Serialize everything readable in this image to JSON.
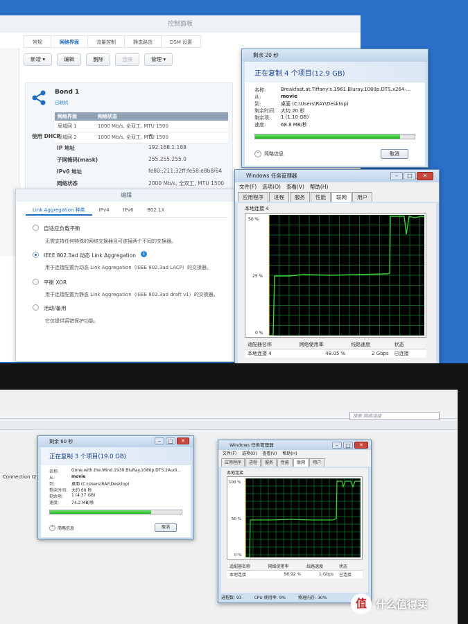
{
  "control_panel": {
    "title": "控制面板",
    "tabs": [
      "常规",
      "网络界面",
      "流量控制",
      "静态路由",
      "DSM 设置"
    ],
    "active_tab": 1,
    "toolbar": {
      "create": "新增 ▾",
      "edit": "编辑",
      "delete": "删除",
      "connect": "连接",
      "manage": "管理 ▾"
    },
    "bond": {
      "name": "Bond 1",
      "status": "已联机",
      "table_headers": [
        "网络界面",
        "网络状态"
      ],
      "interfaces": [
        {
          "name": "局域网 1",
          "status": "1000 Mb/s, 全双工, MTU 1500"
        },
        {
          "name": "局域网 2",
          "status": "1000 Mb/s, 全双工, MTU 1500"
        }
      ],
      "fields": [
        {
          "label": "使用 DHCP",
          "value": "否"
        },
        {
          "label": "IP 地址",
          "value": "192.168.1.188"
        },
        {
          "label": "子网掩码(mask)",
          "value": "255.255.255.0"
        },
        {
          "label": "IPv6 地址",
          "value": "fe80::211:32ff:fe58:e8b8/64"
        },
        {
          "label": "网络状态",
          "value": "2000 Mb/s, 全双工, MTU 1500"
        }
      ]
    }
  },
  "edit_dialog": {
    "title": "编辑",
    "tabs": [
      "Link Aggregation 种类",
      "IPv4",
      "IPv6",
      "802.1X"
    ],
    "options": [
      {
        "label": "自适应负载平衡",
        "desc": "无需支持任何特殊的网络交换器且可连接两个不同的交换器。",
        "selected": false
      },
      {
        "label": "IEEE 802.3ad 动态 Link Aggregation",
        "desc": "用于连接配置为动态 Link Aggregation（IEEE 802.3ad LACP）的交换器。",
        "selected": true
      },
      {
        "label": "平衡 XOR",
        "desc": "用于连接配置为静态 Link Aggregation（IEEE 802.3ad draft v1）的交换器。",
        "selected": false
      },
      {
        "label": "活动/备用",
        "desc": "它仅提供容错保护功能。",
        "selected": false
      }
    ]
  },
  "copy_dialog_top": {
    "title": "剩余 20 秒",
    "heading": "正在复制 4 个项目(12.9 GB)",
    "rows": [
      {
        "label": "名称:",
        "value": "Breakfast.at.Tiffany's.1961.Bluray.1080p.DTS.x264-..."
      },
      {
        "label": "从:",
        "value": "movie"
      },
      {
        "label": "到:",
        "value": "桌面 (C:\\Users\\RAY\\Desktop)"
      },
      {
        "label": "剩余时间:",
        "value": "大约 20 秒"
      },
      {
        "label": "剩余项:",
        "value": "1 (1.10 GB)"
      },
      {
        "label": "速度:",
        "value": "68.8 MB/秒"
      }
    ],
    "progress": 0.91,
    "details": "简略信息",
    "cancel": "取消"
  },
  "taskmgr_top": {
    "title": "Windows 任务管理器",
    "menu": [
      "文件(F)",
      "选项(O)",
      "查看(V)",
      "帮助(H)"
    ],
    "tabs": [
      "应用程序",
      "进程",
      "服务",
      "性能",
      "联网",
      "用户"
    ],
    "active_tab": 4,
    "graph_title": "本地连接 4",
    "y_labels": [
      "50 %",
      "25 %",
      "0 %"
    ],
    "headers": [
      "适配器名称",
      "网络使用率",
      "线路速度",
      "状态"
    ],
    "row": [
      "本地连接 4",
      "48.05 %",
      "2 Gbps",
      "已连接"
    ]
  },
  "laptop": {
    "search_placeholder": "搜索 网络连接",
    "connection_label": "Connection I2...",
    "copy_dialog": {
      "title": "剩余 60 秒",
      "heading": "正在复制 3 个项目(19.0 GB)",
      "rows": [
        {
          "label": "名称:",
          "value": "Gone.with.the.Wind.1939.BluRay.1080p.DTS.2Audi..."
        },
        {
          "label": "从:",
          "value": "movie"
        },
        {
          "label": "到:",
          "value": "桌面 (C:\\Users\\RAY\\Desktop)"
        },
        {
          "label": "剩余时间:",
          "value": "大约 60 秒"
        },
        {
          "label": "剩余项:",
          "value": "1 (4.37 GB)"
        },
        {
          "label": "速度:",
          "value": "74.2 MB/秒"
        }
      ],
      "progress": 0.77,
      "details": "简略信息",
      "cancel": "取消"
    },
    "taskmgr": {
      "title": "Windows 任务管理器",
      "menu": [
        "文件(F)",
        "选项(O)",
        "查看(V)",
        "帮助(H)"
      ],
      "tabs": [
        "应用程序",
        "进程",
        "服务",
        "性能",
        "联网",
        "用户"
      ],
      "active_tab": 4,
      "graph_title": "本地连接",
      "y_labels": [
        "100 %",
        "50 %",
        "0 %"
      ],
      "headers": [
        "适配器名称",
        "网络使用率",
        "线路速度",
        "状态"
      ],
      "row": [
        "本地连接",
        "98.92 %",
        "1 Gbps",
        "已连接"
      ],
      "status": [
        "进程数: 93",
        "CPU 使用率: 9%",
        "物理内存: 30%"
      ]
    }
  },
  "watermark": {
    "logo": "值",
    "text": "什么值得买"
  },
  "colors": {
    "accent": "#1f6bc0",
    "graph_line": "#3bd43b",
    "graph_grid": "#0f7a2e",
    "progress": "#1fb51f"
  }
}
